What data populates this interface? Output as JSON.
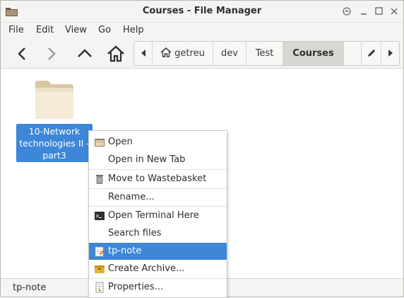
{
  "window": {
    "title": "Courses - File Manager",
    "controls": [
      "restore-up-icon",
      "minimize-icon",
      "maximize-icon",
      "close-icon"
    ]
  },
  "menubar": {
    "items": [
      "File",
      "Edit",
      "View",
      "Go",
      "Help"
    ]
  },
  "toolbar": {
    "buttons": [
      "back-icon",
      "forward-icon",
      "up-icon",
      "home-icon"
    ]
  },
  "pathbar": {
    "segments": [
      "getreu",
      "dev",
      "Test",
      "Courses"
    ],
    "active": "Courses"
  },
  "folder": {
    "label_lines": [
      "10-Network",
      "technologies II -",
      "part3"
    ]
  },
  "context_menu": {
    "items": [
      {
        "label": "Open",
        "icon": "open-folder-icon"
      },
      {
        "label": "Open in New Tab",
        "icon": ""
      },
      {
        "label": "Move to Wastebasket",
        "icon": "trash-icon"
      },
      {
        "label": "Rename...",
        "icon": ""
      },
      {
        "label": "Open Terminal Here",
        "icon": "terminal-icon"
      },
      {
        "label": "Search files",
        "icon": ""
      },
      {
        "label": "tp-note",
        "icon": "note-icon",
        "highlighted": true
      },
      {
        "label": "Create Archive...",
        "icon": "archive-icon"
      },
      {
        "label": "Properties...",
        "icon": "properties-icon"
      }
    ]
  },
  "statusbar": {
    "text": "tp-note"
  },
  "colors": {
    "selection": "#3d86d8",
    "chrome": "#f4f4f3",
    "folder": "#e8d9b8"
  }
}
